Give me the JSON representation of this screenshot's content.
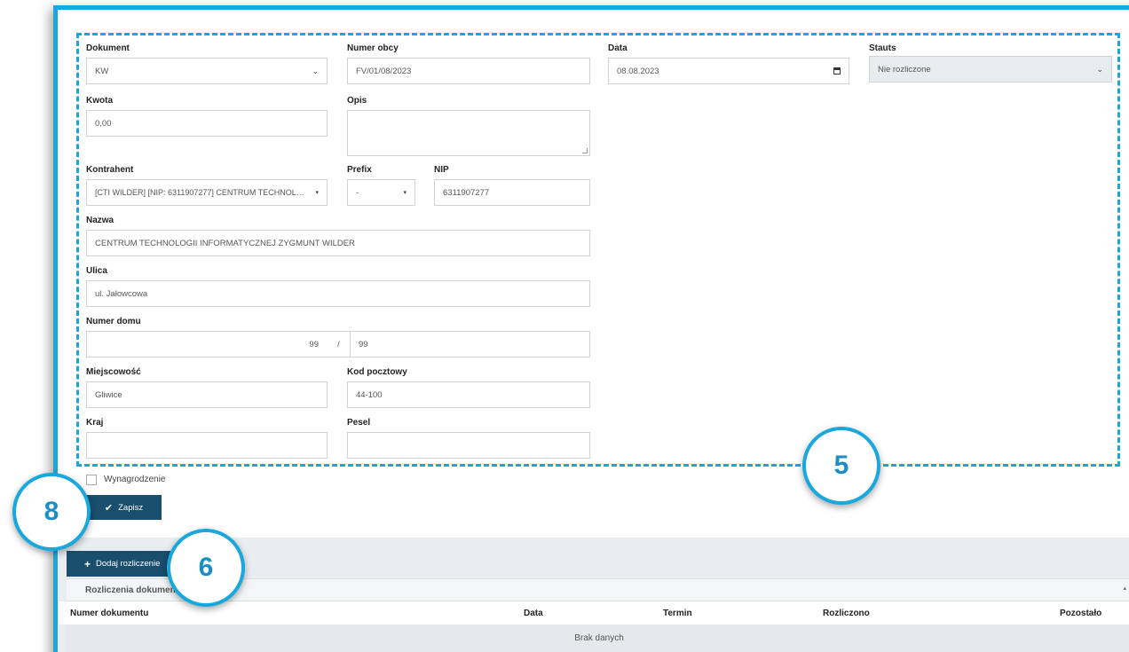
{
  "form": {
    "dokument": {
      "label": "Dokument",
      "value": "KW"
    },
    "numer_obcy": {
      "label": "Numer obcy",
      "value": "FV/01/08/2023"
    },
    "data": {
      "label": "Data",
      "value": "08.08.2023"
    },
    "status": {
      "label": "Stauts",
      "value": "Nie rozliczone"
    },
    "kwota": {
      "label": "Kwota",
      "value": "0,00"
    },
    "opis": {
      "label": "Opis",
      "value": ""
    },
    "kontrahent": {
      "label": "Kontrahent",
      "value": "[CTI WILDER] [NIP: 6311907277] CENTRUM TECHNOLOGII ..."
    },
    "prefix": {
      "label": "Prefix",
      "value": "-"
    },
    "nip": {
      "label": "NIP",
      "value": "6311907277"
    },
    "nazwa": {
      "label": "Nazwa",
      "value": "CENTRUM TECHNOLOGII INFORMATYCZNEJ ZYGMUNT WILDER"
    },
    "ulica": {
      "label": "Ulica",
      "value": "ul. Jałowcowa"
    },
    "numer_domu": {
      "label": "Numer domu",
      "value": "99",
      "separator": "/",
      "lokal": "99"
    },
    "miejscowosc": {
      "label": "Miejscowość",
      "value": "Gliwice"
    },
    "kod_pocztowy": {
      "label": "Kod pocztowy",
      "value": "44-100"
    },
    "kraj": {
      "label": "Kraj",
      "value": ""
    },
    "pesel": {
      "label": "Pesel",
      "value": ""
    },
    "wynagrodzenie": {
      "label": "Wynagrodzenie",
      "checked": false
    },
    "save_label": "Zapisz"
  },
  "settlements": {
    "add_label": "Dodaj rozliczenie",
    "panel_title": "Rozliczenia dokumentu",
    "collapse_icon": "caret-up-icon",
    "columns": [
      "Numer dokumentu",
      "Data",
      "Termin",
      "Rozliczono",
      "Pozostało"
    ],
    "empty_text": "Brak danych"
  },
  "callouts": {
    "a": "5",
    "b": "8",
    "c": "6"
  },
  "colors": {
    "accent": "#1aa7dc",
    "button": "#1a4e6e"
  }
}
